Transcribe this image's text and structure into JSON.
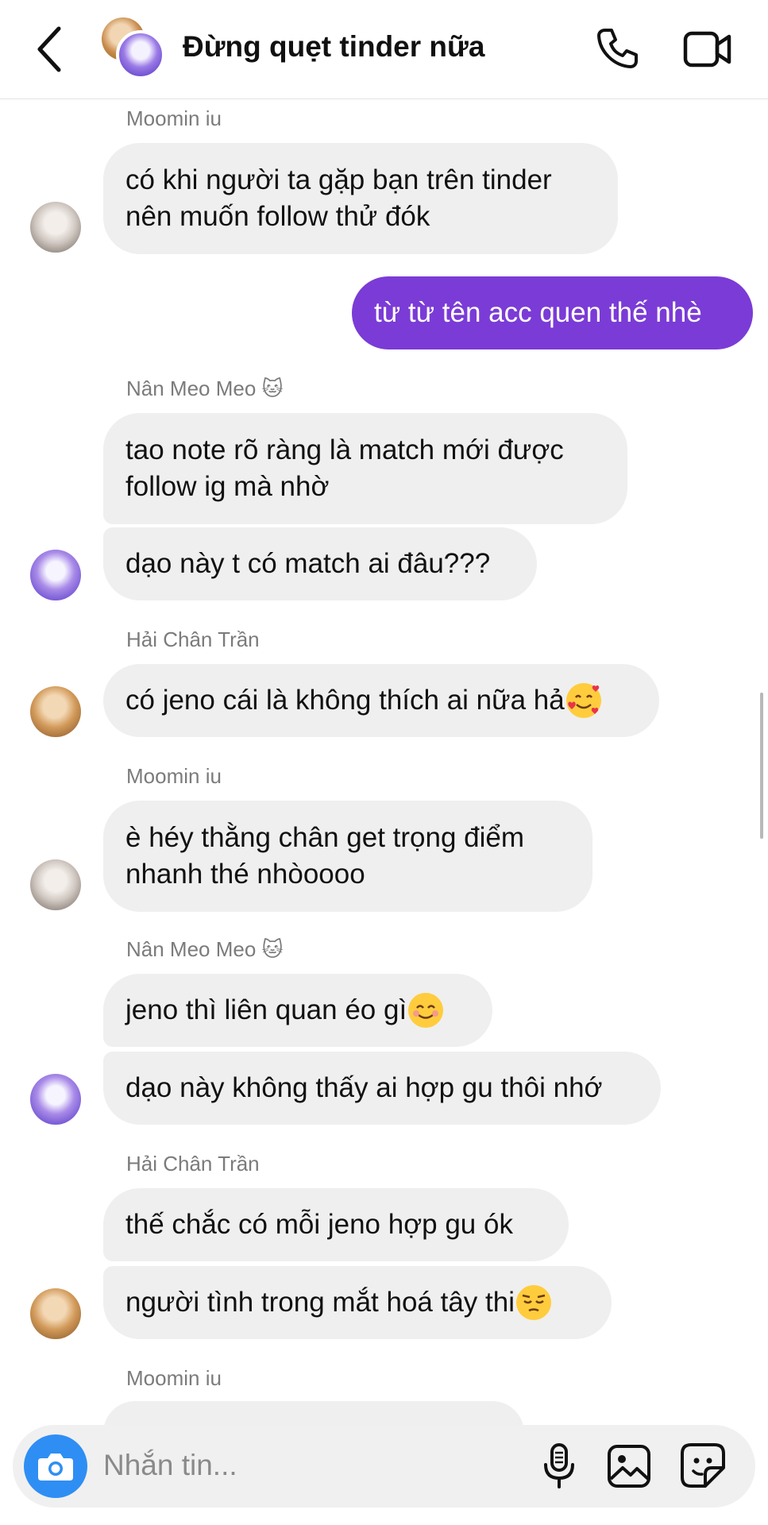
{
  "header": {
    "title": "Đừng quẹt tinder nữa"
  },
  "messages": [
    {
      "sender": "Moomin iu",
      "text": "có khi người ta gặp bạn trên tinder\nnên muốn follow thử đók"
    },
    {
      "outgoing": true,
      "text": "từ từ tên acc quen thế nhè"
    },
    {
      "sender": "Nân Meo Meo 🐱",
      "text": "tao note rõ ràng là match mới được\nfollow ig mà nhờ"
    },
    {
      "text": "dạo này t có match ai đâu???"
    },
    {
      "sender": "Hải Chân Trần",
      "text": "có jeno cái là không thích ai nữa hả",
      "emoji": "smiling-face-with-hearts"
    },
    {
      "sender": "Moomin iu",
      "text": "è héy thằng chân get trọng điểm\nnhanh thé nhòoooo"
    },
    {
      "sender": "Nân Meo Meo 🐱",
      "text": "jeno thì liên quan éo gì",
      "emoji": "smiling-face"
    },
    {
      "text": "dạo này không thấy ai hợp gu thôi nhớ"
    },
    {
      "sender": "Hải Chân Trần",
      "text": "thế chắc có mỗi jeno hợp gu ók"
    },
    {
      "text": "người tình trong mắt hoá tây thi",
      "emoji": "pensive-face"
    },
    {
      "sender": "Moomin iu"
    }
  ],
  "composer": {
    "placeholder": "Nhắn tin..."
  },
  "icons": {
    "back": "chevron-left-icon",
    "call": "phone-icon",
    "video": "video-camera-icon",
    "camera": "camera-icon",
    "mic": "microphone-icon",
    "gallery": "image-icon",
    "sticker": "sticker-icon"
  },
  "colors": {
    "outgoing_bubble": "#7b3bd6",
    "incoming_bubble": "#efefef",
    "camera_button": "#2f8ef4"
  }
}
